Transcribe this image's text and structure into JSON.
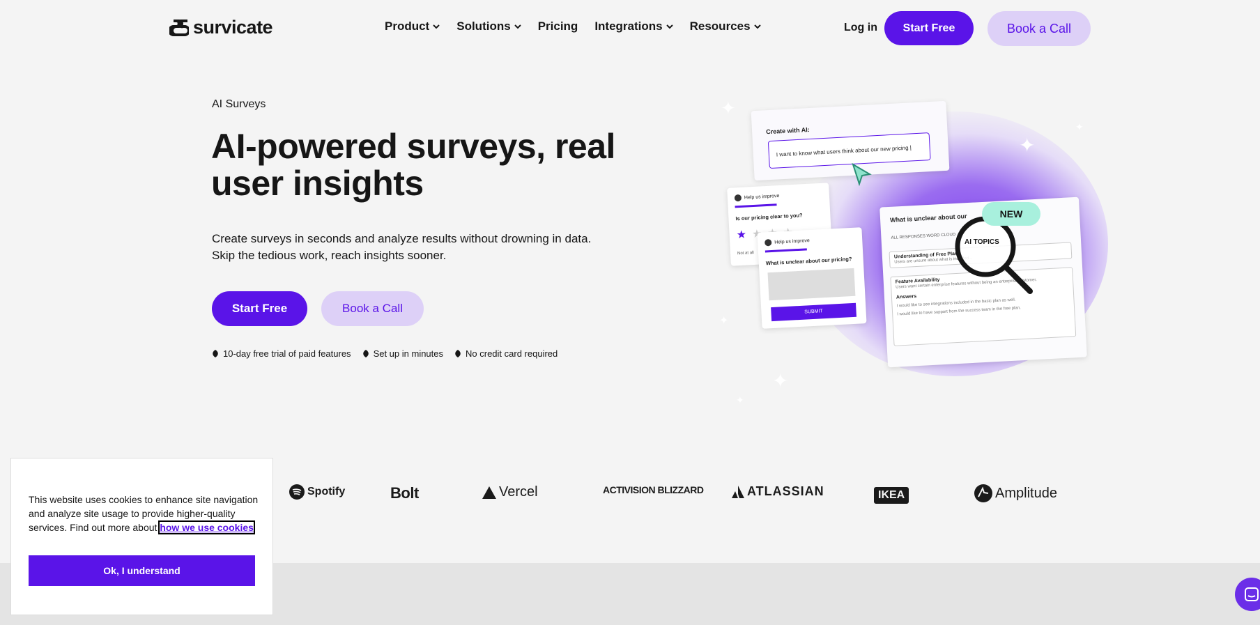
{
  "brand": {
    "name": "survicate",
    "accent": "#5a14e8",
    "accent_light": "#ddd0f7"
  },
  "nav": {
    "items": [
      {
        "label": "Product",
        "dropdown": true
      },
      {
        "label": "Solutions",
        "dropdown": true
      },
      {
        "label": "Pricing",
        "dropdown": false
      },
      {
        "label": "Integrations",
        "dropdown": true
      },
      {
        "label": "Resources",
        "dropdown": true
      }
    ],
    "login": "Log in",
    "start_free": "Start Free",
    "book_call": "Book a Call"
  },
  "hero": {
    "eyebrow": "AI Surveys",
    "title": "AI-powered surveys,  real user insights",
    "subtitle_line1": "Create surveys in seconds and analyze results without drowning in data.",
    "subtitle_line2": "Skip the tedious work, reach insights sooner.",
    "start_free": "Start Free",
    "book_call": "Book a Call",
    "features": [
      "10-day free trial of paid features",
      "Set up in minutes",
      "No credit card required"
    ]
  },
  "illustration": {
    "create_label": "Create with AI:",
    "create_input": "I want to know what users think about our new pricing |",
    "help_label": "Help us improve",
    "rate_question": "Is our pricing clear to you?",
    "rate_min": "Not at all",
    "unclear_question": "What is unclear about our pricing?",
    "submit": "SUBMIT",
    "topics_title": "What is unclear about our",
    "topics_tabs": "ALL RESPONSES   WORD CLOUD",
    "new_badge": "NEW",
    "ai_topics": "AI TOPICS",
    "row1_title": "Understanding of Free Plan",
    "row1_desc": "Users are unsure about what is included...",
    "row2_title": "Feature Availability",
    "row2_desc": "Users want certain enterprise features without being an enterprise customer.",
    "answers_label": "Answers",
    "answer1": "I would like to see integrations included in the basic plan as well.",
    "answer2": "I would like to have support from the success team in the free plan."
  },
  "logos": [
    "Spotify",
    "Bolt",
    "Vercel",
    "ACTIVISION BLIZZARD",
    "ATLASSIAN",
    "IKEA",
    "Amplitude"
  ],
  "cookie": {
    "text": "This website uses cookies to enhance site navigation and analyze site usage to provide higher-quality services. Find out more about ",
    "link": "how we use cookies",
    "button": "Ok, I understand"
  }
}
